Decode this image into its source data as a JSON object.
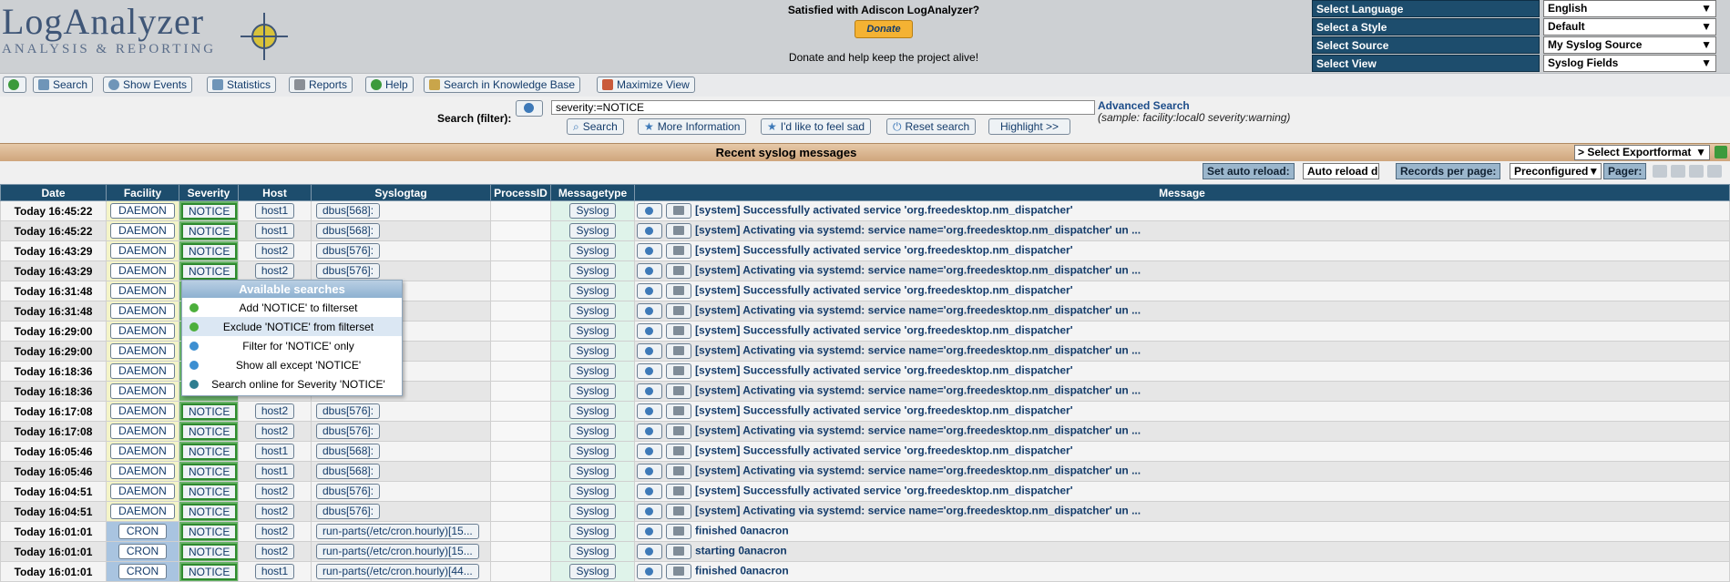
{
  "header": {
    "logo_title": "LogAnalyzer",
    "logo_subtitle": "ANALYSIS & REPORTING",
    "donate_title": "Satisfied with Adiscon LogAnalyzer?",
    "donate_button": "Donate",
    "donate_note": "Donate and help keep the project alive!",
    "selectors": [
      {
        "label": "Select Language",
        "value": "English"
      },
      {
        "label": "Select a Style",
        "value": "Default"
      },
      {
        "label": "Select Source",
        "value": "My Syslog Source"
      },
      {
        "label": "Select View",
        "value": "Syslog Fields"
      }
    ]
  },
  "toolbar": {
    "search": "Search",
    "show_events": "Show Events",
    "statistics": "Statistics",
    "reports": "Reports",
    "help": "Help",
    "knowledge": "Search in Knowledge Base",
    "maximize": "Maximize View"
  },
  "search": {
    "label": "Search (filter):",
    "value": "severity:=NOTICE",
    "advanced": "Advanced Search",
    "sample": "(sample: facility:local0 severity:warning)",
    "btn_search": "Search",
    "btn_more": "More Information",
    "btn_sad": "I'd like to feel sad",
    "btn_reset": "Reset search",
    "btn_highlight": "Highlight >>"
  },
  "recent": {
    "title": "Recent syslog messages",
    "export": "> Select Exportformat"
  },
  "reload": {
    "set_auto": "Set auto reload:",
    "auto_value": "Auto reload d",
    "records": "Records per page:",
    "records_value": "Preconfigured",
    "pager": "Pager:"
  },
  "columns": [
    "Date",
    "Facility",
    "Severity",
    "Host",
    "Syslogtag",
    "ProcessID",
    "Messagetype",
    "Message"
  ],
  "rows": [
    {
      "date": "Today 16:45:22",
      "facility": "DAEMON",
      "severity": "NOTICE",
      "host": "host1",
      "tag": "dbus[568]:",
      "mtype": "Syslog",
      "msg": "[system] Successfully activated service 'org.freedesktop.nm_dispatcher'"
    },
    {
      "date": "Today 16:45:22",
      "facility": "DAEMON",
      "severity": "NOTICE",
      "host": "host1",
      "tag": "dbus[568]:",
      "mtype": "Syslog",
      "msg": "[system] Activating via systemd: service name='org.freedesktop.nm_dispatcher' un ..."
    },
    {
      "date": "Today 16:43:29",
      "facility": "DAEMON",
      "severity": "NOTICE",
      "host": "host2",
      "tag": "dbus[576]:",
      "mtype": "Syslog",
      "msg": "[system] Successfully activated service 'org.freedesktop.nm_dispatcher'"
    },
    {
      "date": "Today 16:43:29",
      "facility": "DAEMON",
      "severity": "NOTICE",
      "host": "host2",
      "tag": "dbus[576]:",
      "mtype": "Syslog",
      "msg": "[system] Activating via systemd: service name='org.freedesktop.nm_dispatcher' un ..."
    },
    {
      "date": "Today 16:31:48",
      "facility": "DAEMON",
      "severity": "",
      "host": "",
      "tag": "",
      "mtype": "Syslog",
      "msg": "[system] Successfully activated service 'org.freedesktop.nm_dispatcher'"
    },
    {
      "date": "Today 16:31:48",
      "facility": "DAEMON",
      "severity": "",
      "host": "",
      "tag": "",
      "mtype": "Syslog",
      "msg": "[system] Activating via systemd: service name='org.freedesktop.nm_dispatcher' un ..."
    },
    {
      "date": "Today 16:29:00",
      "facility": "DAEMON",
      "severity": "",
      "host": "",
      "tag": "",
      "mtype": "Syslog",
      "msg": "[system] Successfully activated service 'org.freedesktop.nm_dispatcher'"
    },
    {
      "date": "Today 16:29:00",
      "facility": "DAEMON",
      "severity": "",
      "host": "",
      "tag": "",
      "mtype": "Syslog",
      "msg": "[system] Activating via systemd: service name='org.freedesktop.nm_dispatcher' un ..."
    },
    {
      "date": "Today 16:18:36",
      "facility": "DAEMON",
      "severity": "",
      "host": "",
      "tag": "",
      "mtype": "Syslog",
      "msg": "[system] Successfully activated service 'org.freedesktop.nm_dispatcher'"
    },
    {
      "date": "Today 16:18:36",
      "facility": "DAEMON",
      "severity": "",
      "host": "",
      "tag": "",
      "mtype": "Syslog",
      "msg": "[system] Activating via systemd: service name='org.freedesktop.nm_dispatcher' un ..."
    },
    {
      "date": "Today 16:17:08",
      "facility": "DAEMON",
      "severity": "NOTICE",
      "host": "host2",
      "tag": "dbus[576]:",
      "mtype": "Syslog",
      "msg": "[system] Successfully activated service 'org.freedesktop.nm_dispatcher'"
    },
    {
      "date": "Today 16:17:08",
      "facility": "DAEMON",
      "severity": "NOTICE",
      "host": "host2",
      "tag": "dbus[576]:",
      "mtype": "Syslog",
      "msg": "[system] Activating via systemd: service name='org.freedesktop.nm_dispatcher' un ..."
    },
    {
      "date": "Today 16:05:46",
      "facility": "DAEMON",
      "severity": "NOTICE",
      "host": "host1",
      "tag": "dbus[568]:",
      "mtype": "Syslog",
      "msg": "[system] Successfully activated service 'org.freedesktop.nm_dispatcher'"
    },
    {
      "date": "Today 16:05:46",
      "facility": "DAEMON",
      "severity": "NOTICE",
      "host": "host1",
      "tag": "dbus[568]:",
      "mtype": "Syslog",
      "msg": "[system] Activating via systemd: service name='org.freedesktop.nm_dispatcher' un ..."
    },
    {
      "date": "Today 16:04:51",
      "facility": "DAEMON",
      "severity": "NOTICE",
      "host": "host2",
      "tag": "dbus[576]:",
      "mtype": "Syslog",
      "msg": "[system] Successfully activated service 'org.freedesktop.nm_dispatcher'"
    },
    {
      "date": "Today 16:04:51",
      "facility": "DAEMON",
      "severity": "NOTICE",
      "host": "host2",
      "tag": "dbus[576]:",
      "mtype": "Syslog",
      "msg": "[system] Activating via systemd: service name='org.freedesktop.nm_dispatcher' un ..."
    },
    {
      "date": "Today 16:01:01",
      "facility": "CRON",
      "severity": "NOTICE",
      "host": "host2",
      "tag": "run-parts(/etc/cron.hourly)[15...",
      "mtype": "Syslog",
      "msg": "finished 0anacron"
    },
    {
      "date": "Today 16:01:01",
      "facility": "CRON",
      "severity": "NOTICE",
      "host": "host2",
      "tag": "run-parts(/etc/cron.hourly)[15...",
      "mtype": "Syslog",
      "msg": "starting 0anacron"
    },
    {
      "date": "Today 16:01:01",
      "facility": "CRON",
      "severity": "NOTICE",
      "host": "host1",
      "tag": "run-parts(/etc/cron.hourly)[44...",
      "mtype": "Syslog",
      "msg": "finished 0anacron"
    }
  ],
  "popup": {
    "title": "Available searches",
    "items": [
      {
        "label": "Add 'NOTICE' to filterset",
        "color": "#4caf3c"
      },
      {
        "label": "Exclude 'NOTICE' from filterset",
        "color": "#4caf3c"
      },
      {
        "label": "Filter for 'NOTICE' only",
        "color": "#3d8fd1"
      },
      {
        "label": "Show all except 'NOTICE'",
        "color": "#3d8fd1"
      },
      {
        "label": "Search online for Severity 'NOTICE'",
        "color": "#2e7d8f"
      }
    ]
  }
}
